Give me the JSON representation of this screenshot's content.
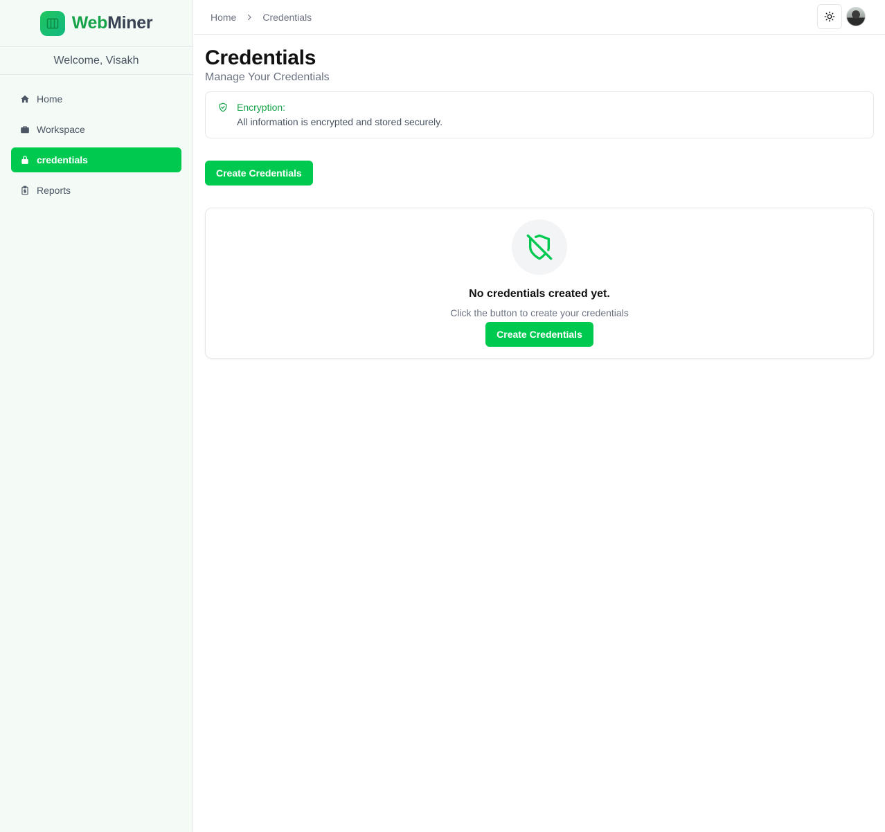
{
  "brand": {
    "part1": "Web",
    "part2": "Miner",
    "accent": "#16a34a"
  },
  "sidebar": {
    "welcome": "Welcome, Visakh",
    "items": [
      {
        "label": "Home",
        "icon": "home-icon",
        "active": false
      },
      {
        "label": "Workspace",
        "icon": "briefcase-icon",
        "active": false
      },
      {
        "label": "credentials",
        "icon": "lock-icon",
        "active": true
      },
      {
        "label": "Reports",
        "icon": "clipboard-icon",
        "active": false
      }
    ]
  },
  "header": {
    "breadcrumb": [
      "Home",
      "Credentials"
    ],
    "theme_icon": "sun-icon",
    "avatar": "user-avatar"
  },
  "page": {
    "title": "Credentials",
    "subtitle": "Manage Your Credentials",
    "alert": {
      "title": "Encryption:",
      "text": "All information is encrypted and stored securely.",
      "icon": "shield-check-icon"
    },
    "create_button": "Create Credentials",
    "empty_state": {
      "icon": "shield-off-icon",
      "title": "No credentials created yet.",
      "subtitle": "Click the button to create your credentials",
      "button": "Create Credentials"
    }
  },
  "colors": {
    "primary": "#00c950",
    "sidebar_bg": "#f4faf6",
    "border": "#e5e7eb"
  }
}
